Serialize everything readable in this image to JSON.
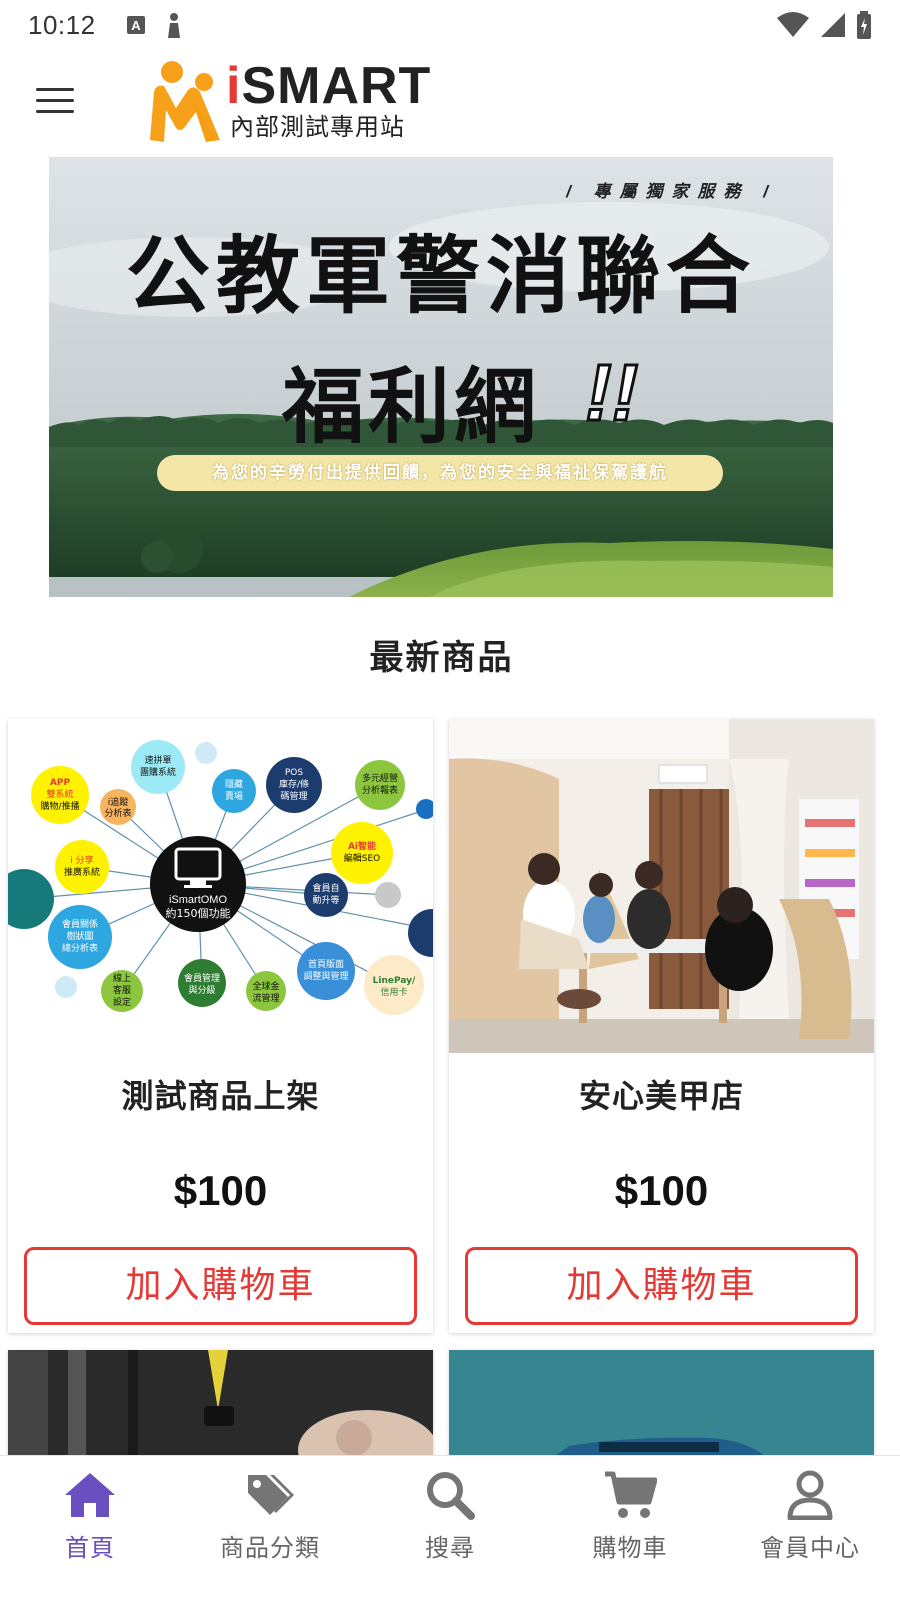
{
  "status_bar": {
    "time": "10:12"
  },
  "header": {
    "brand": "SMART",
    "brand_i": "i",
    "subtitle": "內部測試專用站"
  },
  "banner": {
    "tag": "/ 專屬獨家服務 /",
    "title_line1": "公教軍警消聯合",
    "title_line2": "福利網",
    "exclaim": "!!",
    "ribbon": "為您的辛勞付出提供回饋，為您的安全與福祉保駕護航"
  },
  "section": {
    "title": "最新商品"
  },
  "products": [
    {
      "name": "測試商品上架",
      "price": "$100",
      "cta": "加入購物車"
    },
    {
      "name": "安心美甲店",
      "price": "$100",
      "cta": "加入購物車"
    }
  ],
  "diagram": {
    "center_line1": "iSmartOMO",
    "center_line2": "約150個功能",
    "bubbles": [
      "速拼單團購系統",
      "APP雙系統購物/推播",
      "i追蹤分析表",
      "隱藏賣場",
      "POS庫存/條碼管理",
      "多元經營分析報表",
      "Ai智能編輯SEO",
      "i分享推廣系統",
      "會員自動升等",
      "會員關係樹狀圖總分析表",
      "首頁版面調整與管理",
      "線上客服設定",
      "會員管理與分級",
      "全球金流管理",
      "LinePay/信用卡"
    ]
  },
  "bottom_nav": [
    {
      "label": "首頁",
      "icon": "home-icon",
      "active": true
    },
    {
      "label": "商品分類",
      "icon": "tags-icon",
      "active": false
    },
    {
      "label": "搜尋",
      "icon": "search-icon",
      "active": false
    },
    {
      "label": "購物車",
      "icon": "cart-icon",
      "active": false
    },
    {
      "label": "會員中心",
      "icon": "user-icon",
      "active": false
    }
  ],
  "colors": {
    "accent_red": "#e53935",
    "nav_active": "#6a4fc1",
    "logo_orange": "#f7a11a"
  }
}
